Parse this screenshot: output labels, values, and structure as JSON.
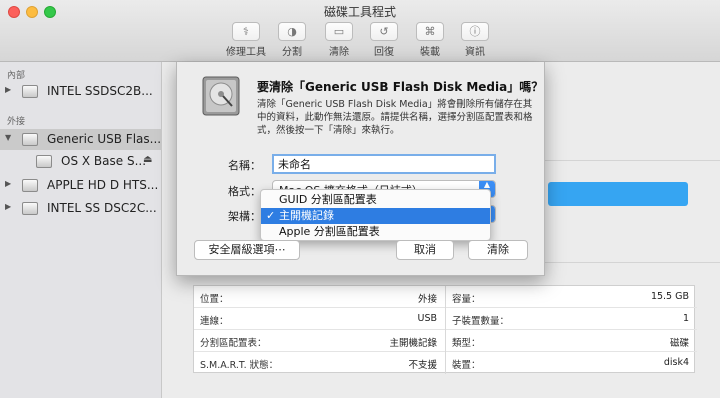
{
  "window": {
    "title": "磁碟工具程式"
  },
  "toolbar": {
    "items": [
      {
        "label": "修理工具",
        "icon": "stethoscope-icon"
      },
      {
        "label": "分割",
        "icon": "partition-icon"
      },
      {
        "label": "清除",
        "icon": "erase-icon"
      },
      {
        "label": "回復",
        "icon": "restore-icon"
      },
      {
        "label": "裝載",
        "icon": "mount-icon"
      },
      {
        "label": "資訊",
        "icon": "info-icon"
      }
    ]
  },
  "sidebar": {
    "section_internal": "內部",
    "section_external": "外接",
    "items": [
      {
        "name": "INTEL SSDSC2B..."
      },
      {
        "name": "Generic USB Flas..."
      },
      {
        "name": "OS X Base S..."
      },
      {
        "name": "APPLE HD D HTS..."
      },
      {
        "name": "INTEL SS DSC2C..."
      }
    ]
  },
  "dialog": {
    "title": "要清除「Generic USB Flash Disk Media」嗎？",
    "description": "清除「Generic USB Flash Disk Media」將會刪除所有儲存在其中的資料，此動作無法還原。請提供名稱，選擇分割區配置表和格式，然後按一下「清除」來執行。",
    "name_label": "名稱：",
    "name_value": "未命名",
    "format_label": "格式：",
    "format_value": "Mac OS 擴充格式（日誌式）",
    "scheme_label": "架構：",
    "scheme_menu": [
      "GUID 分割區配置表",
      "主開機記錄",
      "Apple 分割區配置表"
    ],
    "scheme_selected": "主開機記錄",
    "security_button": "安全層級選項⋯",
    "cancel_button": "取消",
    "erase_button": "清除"
  },
  "info": {
    "left": [
      {
        "key": "位置：",
        "value": "外接"
      },
      {
        "key": "連線：",
        "value": "USB"
      },
      {
        "key": "分割區配置表：",
        "value": "主開機記錄"
      },
      {
        "key": "S.M.A.R.T. 狀態：",
        "value": "不支援"
      }
    ],
    "right": [
      {
        "key": "容量：",
        "value": "15.5 GB"
      },
      {
        "key": "子裝置數量：",
        "value": "1"
      },
      {
        "key": "類型：",
        "value": "磁碟"
      },
      {
        "key": "裝置：",
        "value": "disk4"
      }
    ]
  },
  "colors": {
    "accent": "#2e7de2",
    "selection_bar": "#36a5f2"
  }
}
